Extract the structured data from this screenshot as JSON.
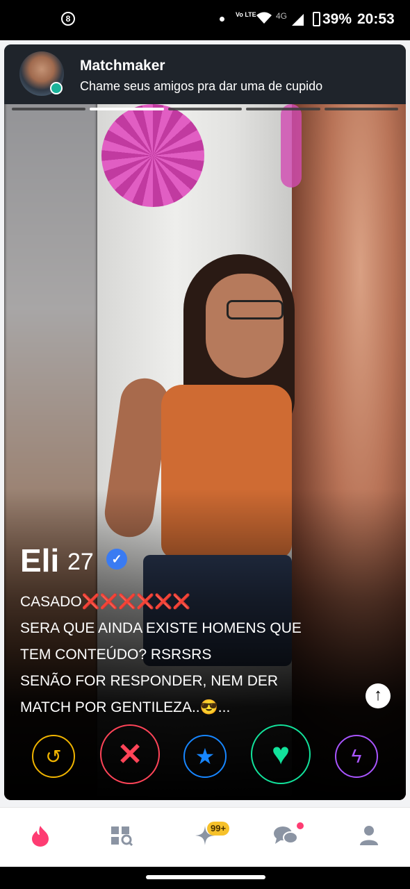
{
  "status_bar": {
    "volte": "Vo LTE",
    "network": "4G",
    "battery": "39%",
    "time": "20:53"
  },
  "matchmaker": {
    "title": "Matchmaker",
    "subtitle": "Chame seus amigos pra dar uma de cupido"
  },
  "photo_progress": {
    "total": 5,
    "current": 2
  },
  "profile": {
    "name": "Eli",
    "age": "27",
    "verified": true,
    "bio_lines": [
      "CASADO❌❌❌❌❌❌",
      "SERA QUE AINDA EXISTE HOMENS QUE",
      "TEM CONTEÚDO? RSRSRS",
      "SENÃO FOR RESPONDER, NEM DER",
      "MATCH POR GENTILEZA..😎..."
    ]
  },
  "actions": [
    {
      "name": "rewind",
      "icon": "rewind-icon",
      "color": "#f0b400"
    },
    {
      "name": "nope",
      "icon": "x-icon",
      "color": "#ff4458"
    },
    {
      "name": "super-like",
      "icon": "star-icon",
      "color": "#1786ff"
    },
    {
      "name": "like",
      "icon": "heart-icon",
      "color": "#12e29b"
    },
    {
      "name": "boost",
      "icon": "lightning-icon",
      "color": "#a955ff"
    }
  ],
  "bottom_nav": {
    "likes_badge": "99+",
    "items": [
      "home-flame-icon",
      "explore-icon",
      "likes-sparkle-icon",
      "chat-icon",
      "profile-icon"
    ]
  },
  "colors": {
    "brand": "#fe3c72",
    "card_bg": "#000000"
  }
}
